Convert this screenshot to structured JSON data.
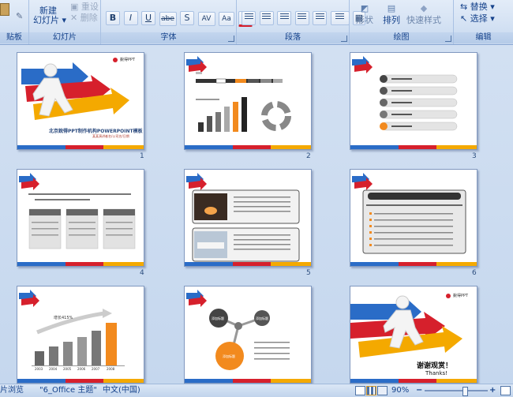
{
  "ribbon": {
    "clipboard_group": "贴板",
    "paste_partial": "粘贴",
    "slides": {
      "new_slide_line1": "新建",
      "new_slide_line2": "幻灯片",
      "reset": "重设",
      "delete": "删除",
      "group": "幻灯片"
    },
    "font": {
      "group": "字体",
      "bold": "B",
      "italic": "I",
      "underline": "U",
      "strike": "abe",
      "shadow": "S",
      "spacing": "AV",
      "case": "Aa",
      "color": "A"
    },
    "paragraph": {
      "group": "段落"
    },
    "drawing": {
      "shape": "形状",
      "arrange": "排列",
      "quick_styles": "快速样式",
      "group": "绘图"
    },
    "editing": {
      "replace": "替换",
      "select": "选择",
      "group": "编辑"
    }
  },
  "slides": [
    {
      "number": "1",
      "title": "北京銳得PPT制作机构POWERPOINT模板",
      "subtitle": "某某演讲者名/公司名/日期",
      "logo_text": "銳得PPT"
    },
    {
      "number": "2"
    },
    {
      "number": "3"
    },
    {
      "number": "4"
    },
    {
      "number": "5"
    },
    {
      "number": "6"
    },
    {
      "number": "7",
      "chart_label": "增长415%",
      "years": [
        "2003",
        "2004",
        "2005",
        "2006",
        "2007",
        "2008"
      ]
    },
    {
      "number": "8",
      "nodes": [
        "添加标题",
        "添加标题",
        "添加标题"
      ]
    },
    {
      "number": "9",
      "thanks_cn": "谢谢观赏！",
      "thanks_en": "Thanks!",
      "logo_text": "銳得PPT"
    }
  ],
  "status_bar": {
    "view": "片浏览",
    "theme": "\"6_Office 主题\"",
    "language": "中文(中国)",
    "zoom": "90%"
  },
  "colors": {
    "blue": "#2a6cc7",
    "red": "#d6202c",
    "orange": "#f4a900",
    "ribbon_bg": "#d3e1f3"
  }
}
